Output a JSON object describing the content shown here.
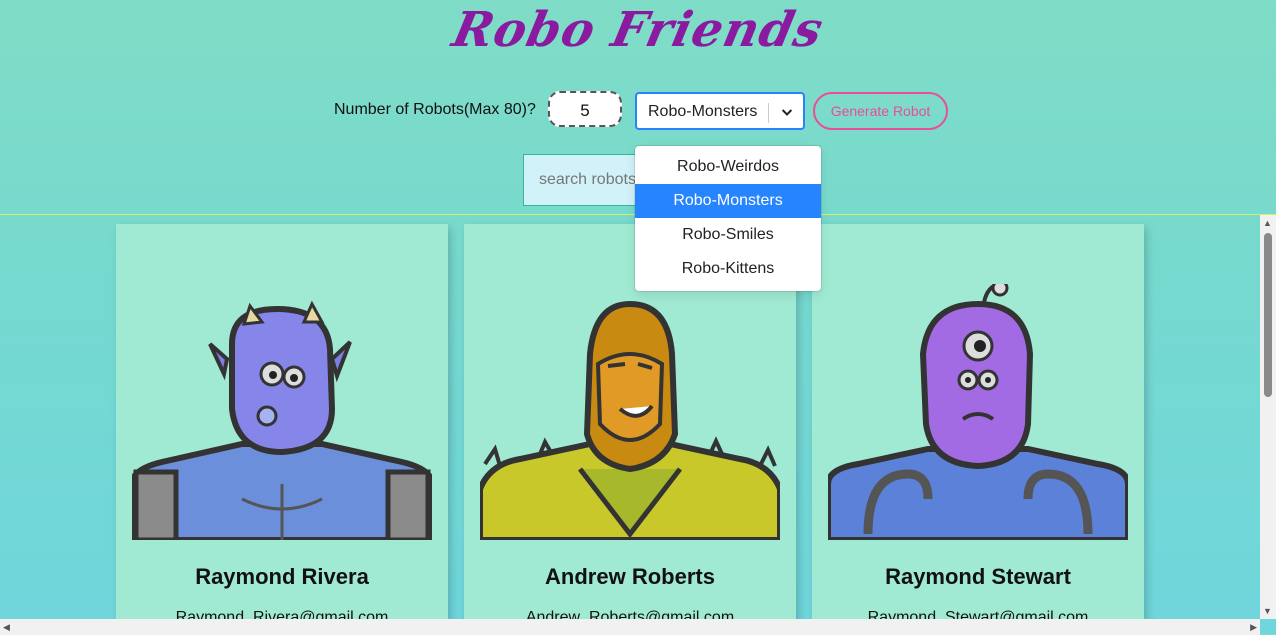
{
  "header": {
    "title": "Robo Friends"
  },
  "controls": {
    "count_label": "Number of Robots(Max 80)?",
    "count_value": "5",
    "select_value": "Robo-Monsters",
    "generate_label": "Generate Robot"
  },
  "search": {
    "placeholder": "search robots"
  },
  "dropdown": {
    "options": [
      "Robo-Weirdos",
      "Robo-Monsters",
      "Robo-Smiles",
      "Robo-Kittens"
    ],
    "selected": "Robo-Monsters"
  },
  "cards": [
    {
      "name": "Raymond Rivera",
      "email": "Raymond_Rivera@gmail.com"
    },
    {
      "name": "Andrew Roberts",
      "email": "Andrew_Roberts@gmail.com"
    },
    {
      "name": "Raymond Stewart",
      "email": "Raymond_Stewart@gmail.com"
    }
  ],
  "colors": {
    "title": "#8a1aa0",
    "accent": "#e84e9a",
    "focus": "#2684ff",
    "card": "#a0ead3"
  }
}
